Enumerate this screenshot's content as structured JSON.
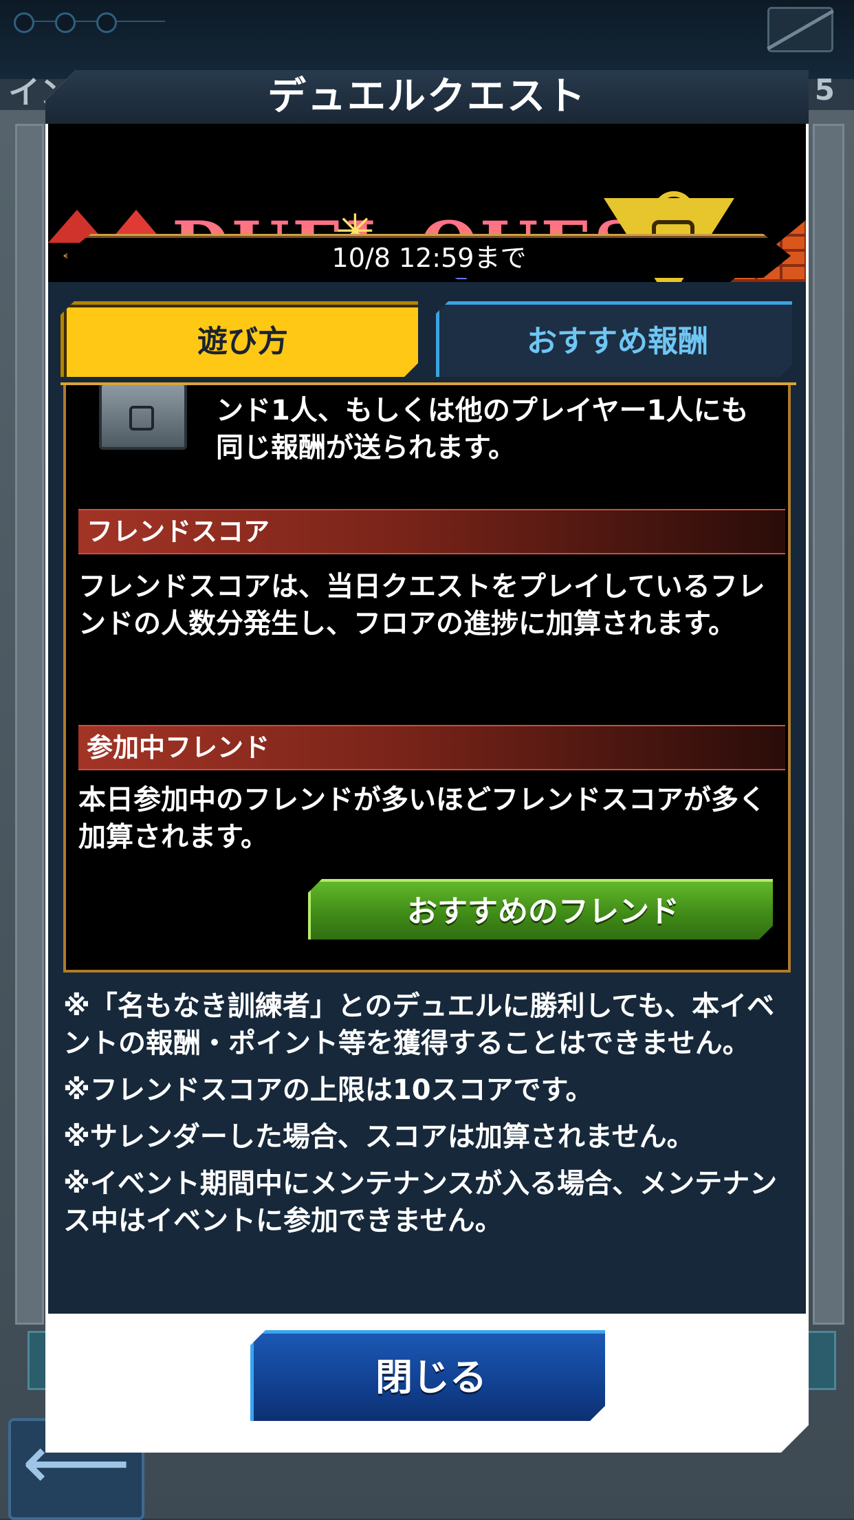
{
  "background": {
    "title_fragment": "イン",
    "count": "5",
    "back_arrow": "back-arrow-icon"
  },
  "dialog": {
    "title": "デュエルクエスト",
    "banner": {
      "logo_text": "DUEL QUEST",
      "period": "10/8 12:59まで"
    },
    "tabs": [
      {
        "label": "遊び方",
        "active": true
      },
      {
        "label": "おすすめ報酬",
        "active": false
      }
    ],
    "content": {
      "intro_text": "ンド1人、もしくは他のプレイヤー1人にも同じ報酬が送られます。",
      "sections": [
        {
          "heading": "フレンドスコア",
          "body": "フレンドスコアは、当日クエストをプレイしているフレンドの人数分発生し、フロアの進捗に加算されます。"
        },
        {
          "heading": "参加中フレンド",
          "body": "本日参加中のフレンドが多いほどフレンドスコアが多く加算されます。"
        }
      ],
      "friend_button": "おすすめのフレンド"
    },
    "notes": [
      "※「名もなき訓練者」とのデュエルに勝利しても、本イベントの報酬・ポイント等を獲得することはできません。",
      "※フレンドスコアの上限は10スコアです。",
      "※サレンダーした場合、スコアは加算されません。",
      "※イベント期間中にメンテナンスが入る場合、メンテナンス中はイベントに参加できません。"
    ],
    "close_button": "閉じる"
  },
  "colors": {
    "tab_active": "#ffc815",
    "tab_inactive_text": "#6fc6f3",
    "section_header": "#a33426",
    "friend_button": "#4f9f20",
    "close_button": "#1b58b4"
  }
}
